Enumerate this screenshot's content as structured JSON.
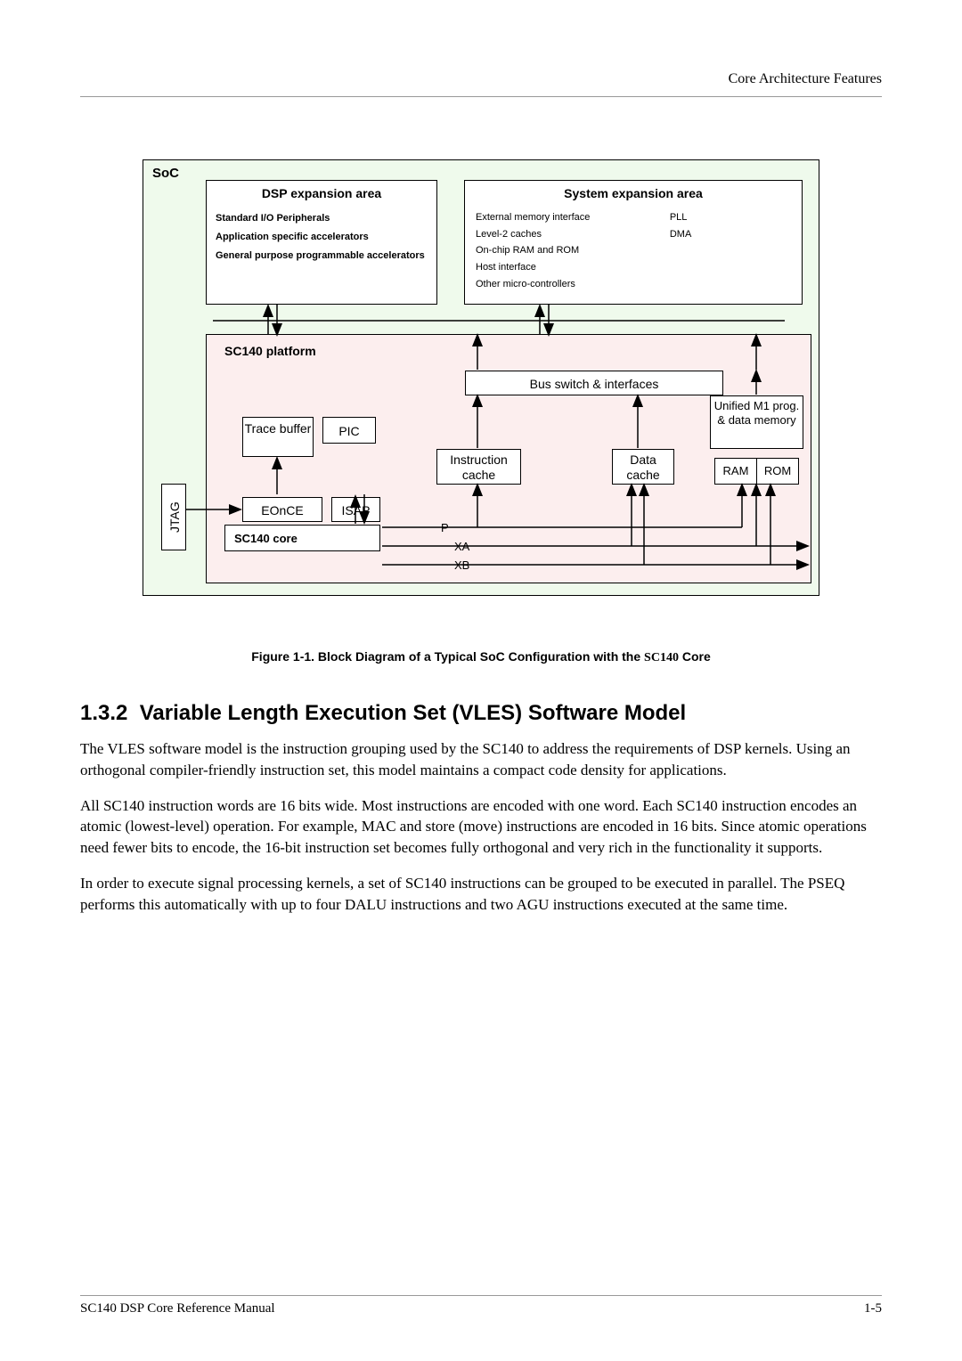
{
  "header": "Core Architecture Features",
  "diagram": {
    "soc": "SoC",
    "dsp": {
      "title": "DSP expansion area",
      "line1": "Standard I/O Peripherals",
      "line2": "Application specific accelerators",
      "line3": "General purpose programmable accelerators"
    },
    "sys": {
      "title": "System expansion area",
      "l1": "External memory interface",
      "l2": "Level-2 caches",
      "l3": "On-chip RAM and ROM",
      "l4": "Host interface",
      "l5": "Other micro-controllers",
      "r1": "PLL",
      "r2": "DMA"
    },
    "platform": "SC140 platform",
    "bus_switch": "Bus switch & interfaces",
    "trace_buffer": "Trace buffer",
    "pic": "PIC",
    "instr_cache": "Instruction cache",
    "data_cache": "Data cache",
    "unified": "Unified M1 prog. & data memory",
    "ram": "RAM",
    "rom": "ROM",
    "eonce": "EOnCE",
    "isap": "ISAP",
    "core": "SC140 core",
    "jtag": "JTAG",
    "p": "P",
    "xa": "XA",
    "xb": "XB"
  },
  "figure_caption_prefix": "Figure 1-1.   Block Diagram of a Typical SoC Configuration with the ",
  "figure_caption_core": "SC140",
  "figure_caption_suffix": " Core",
  "section": {
    "number": "1.3.2",
    "title": "Variable Length Execution Set (VLES) Software Model"
  },
  "para1": "The VLES software model is the instruction grouping used by the SC140 to address the requirements of DSP kernels. Using an orthogonal compiler-friendly instruction set, this model maintains a compact code density for applications.",
  "para2": "All SC140 instruction words are 16 bits wide. Most instructions are encoded with one word. Each SC140 instruction encodes an atomic (lowest-level) operation. For example, MAC and store (move) instructions are encoded in 16 bits. Since atomic operations need fewer bits to encode, the 16-bit instruction set becomes fully orthogonal and very rich in the functionality it supports.",
  "para3": "In order to execute signal processing kernels, a set of SC140 instructions can be grouped to be executed in parallel. The PSEQ performs this automatically with up to four DALU instructions and two AGU instructions executed at the same time.",
  "footer_left": "SC140 DSP Core Reference Manual",
  "footer_right": "1-5"
}
